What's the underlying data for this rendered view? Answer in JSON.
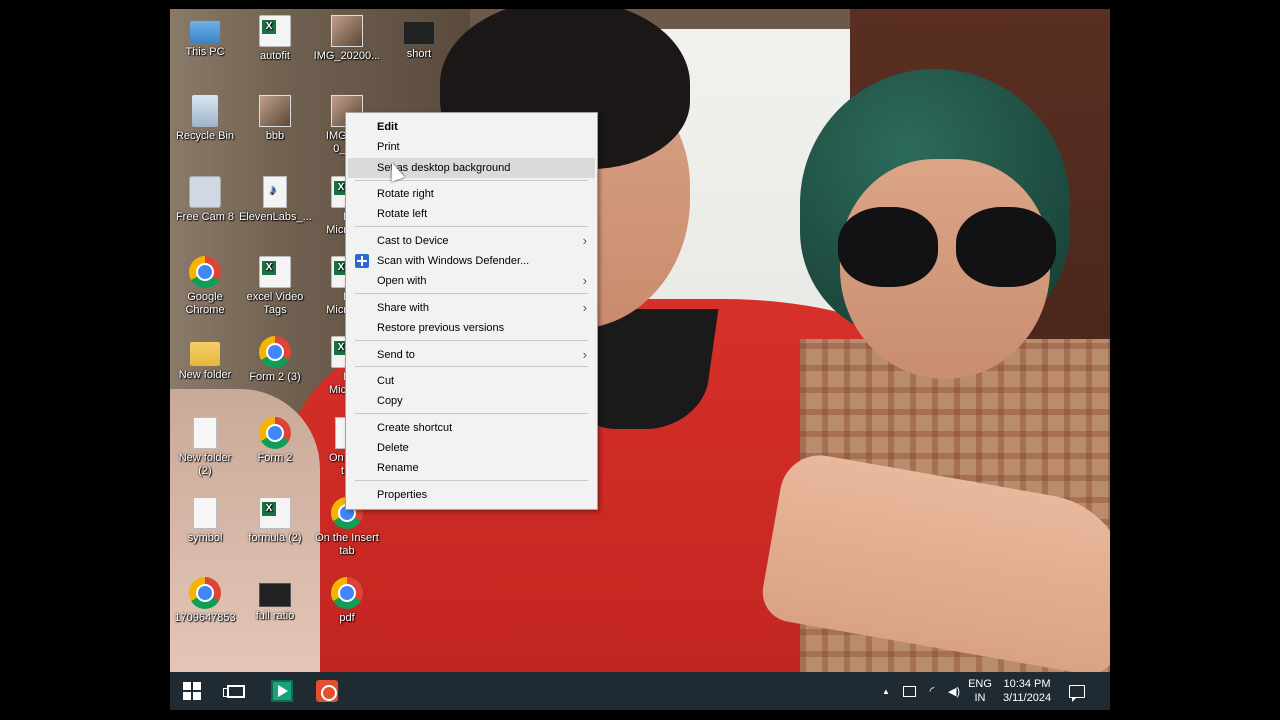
{
  "desktop_icons": [
    {
      "label": "This PC",
      "glyph": "pc"
    },
    {
      "label": "autofit",
      "glyph": "excel"
    },
    {
      "label": "IMG_20200...",
      "glyph": "photo"
    },
    {
      "label": "short",
      "glyph": "dark"
    },
    {
      "label": "Recycle Bin",
      "glyph": "bin"
    },
    {
      "label": "bbb",
      "glyph": "photo"
    },
    {
      "label": "IMG_2...\n0_1...",
      "glyph": "photo"
    },
    {
      "label": "Free Cam 8",
      "glyph": "cam"
    },
    {
      "label": "ElevenLabs_...",
      "glyph": "mp3"
    },
    {
      "label": "N\nMicros...",
      "glyph": "excel"
    },
    {
      "label": "Google\nChrome",
      "glyph": "chrome"
    },
    {
      "label": "excel Video\nTags",
      "glyph": "excel"
    },
    {
      "label": "N\nMicros...",
      "glyph": "excel"
    },
    {
      "label": "New folder",
      "glyph": "folder"
    },
    {
      "label": "Form 2 (3)",
      "glyph": "chrome"
    },
    {
      "label": "N\nMicro...",
      "glyph": "excel"
    },
    {
      "label": "New folder\n(2)",
      "glyph": "doc"
    },
    {
      "label": "Form 2",
      "glyph": "chrome"
    },
    {
      "label": "On th...\nt...",
      "glyph": "doc"
    },
    {
      "label": "symbol",
      "glyph": "doc"
    },
    {
      "label": "formula (2)",
      "glyph": "excel"
    },
    {
      "label": "On the Insert\ntab",
      "glyph": "chrome"
    },
    {
      "label": "1709647853",
      "glyph": "chrome"
    },
    {
      "label": "full ratio",
      "glyph": "dark"
    },
    {
      "label": "pdf",
      "glyph": "chrome"
    }
  ],
  "context_menu": {
    "items": [
      {
        "label": "Edit",
        "bold": true
      },
      {
        "label": "Print"
      },
      {
        "label": "Set as desktop background",
        "hover": true
      },
      {
        "label": "Rotate right"
      },
      {
        "label": "Rotate left"
      },
      {
        "label": "Cast to Device",
        "submenu": true
      },
      {
        "label": "Scan with Windows Defender...",
        "icon": "defender-icon"
      },
      {
        "label": "Open with",
        "submenu": true
      },
      {
        "label": "Share with",
        "submenu": true
      },
      {
        "label": "Restore previous versions"
      },
      {
        "label": "Send to",
        "submenu": true
      },
      {
        "label": "Cut"
      },
      {
        "label": "Copy"
      },
      {
        "label": "Create shortcut"
      },
      {
        "label": "Delete"
      },
      {
        "label": "Rename"
      },
      {
        "label": "Properties"
      }
    ]
  },
  "taskbar": {
    "language_line1": "ENG",
    "language_line2": "IN",
    "time": "10:34 PM",
    "date": "3/11/2024",
    "tray_chevron": "▲"
  },
  "colors": {
    "taskbar_bg": "#1f2a33",
    "menu_bg": "#f2f2f2",
    "menu_hover": "#dadada"
  }
}
